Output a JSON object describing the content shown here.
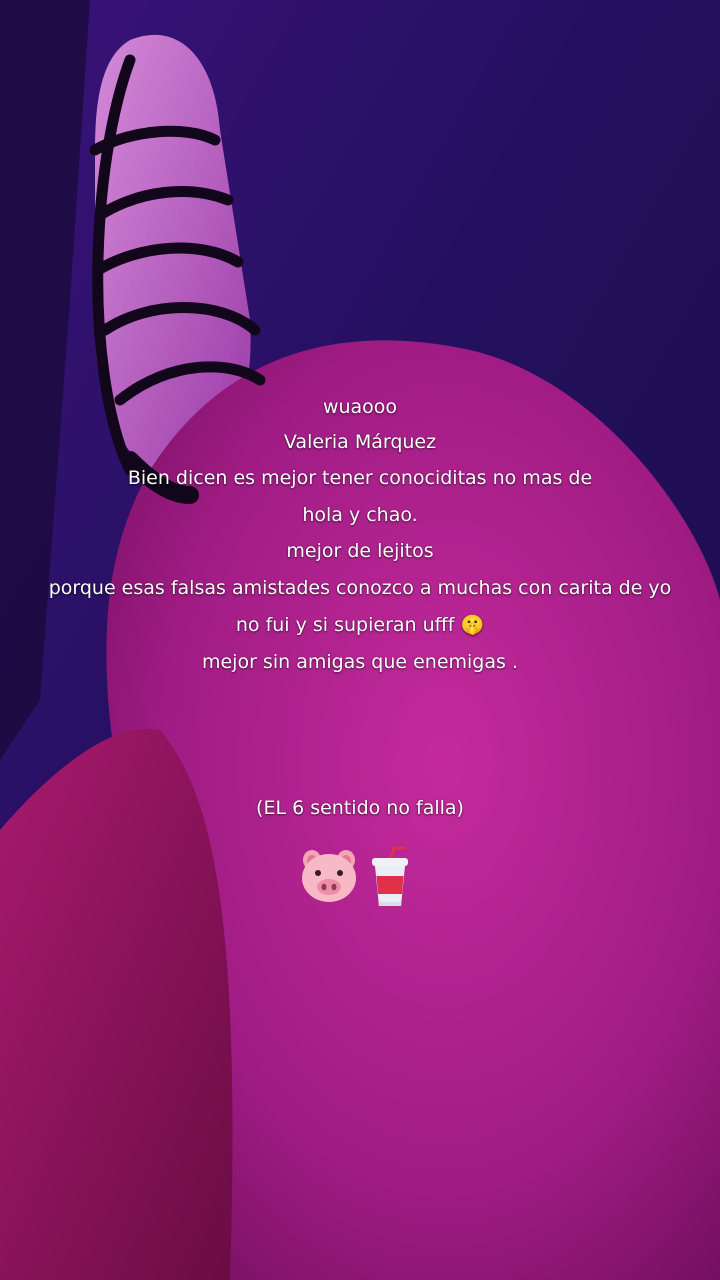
{
  "caption": {
    "lines": [
      "wuaooo",
      "Valeria Márquez",
      "Bien dicen es mejor tener conociditas no mas de",
      "hola y chao.",
      "mejor de lejitos",
      "porque esas falsas amistades conozco a muchas con carita de yo",
      "no fui y si supieran ufff 🤫",
      "mejor sin amigas que enemigas ."
    ],
    "footer": "(EL 6 sentido no falla)"
  },
  "emojis": [
    "pig-face-emoji",
    "cup-with-straw-emoji"
  ],
  "colors": {
    "background_top": "#2a1170",
    "skin_magenta": "#b4208e",
    "skin_deep": "#7a0f60",
    "strap": "#12061a"
  }
}
